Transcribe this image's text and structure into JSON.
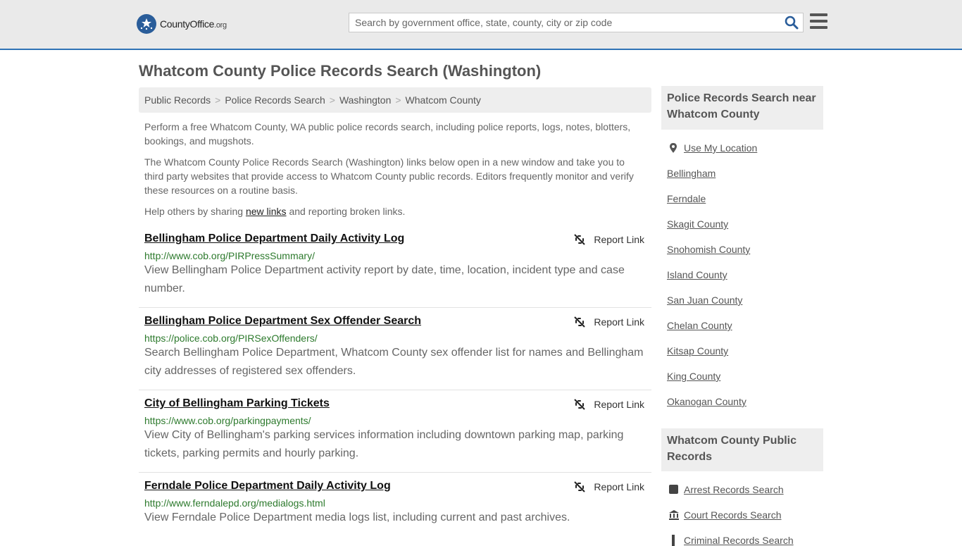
{
  "header": {
    "logo_text": "CountyOffice",
    "logo_suffix": ".org",
    "search_placeholder": "Search by government office, state, county, city or zip code"
  },
  "page": {
    "title": "Whatcom County Police Records Search (Washington)"
  },
  "breadcrumb": [
    "Public Records",
    "Police Records Search",
    "Washington",
    "Whatcom County"
  ],
  "intro": {
    "p1": "Perform a free Whatcom County, WA public police records search, including police reports, logs, notes, blotters, bookings, and mugshots.",
    "p2": "The Whatcom County Police Records Search (Washington) links below open in a new window and take you to third party websites that provide access to Whatcom County public records. Editors frequently monitor and verify these resources on a routine basis.",
    "p3_before": "Help others by sharing ",
    "p3_link": "new links",
    "p3_after": " and reporting broken links."
  },
  "report_label": "Report Link",
  "results": [
    {
      "title": "Bellingham Police Department Daily Activity Log",
      "url": "http://www.cob.org/PIRPressSummary/",
      "desc": "View Bellingham Police Department activity report by date, time, location, incident type and case number."
    },
    {
      "title": "Bellingham Police Department Sex Offender Search",
      "url": "https://police.cob.org/PIRSexOffenders/",
      "desc": "Search Bellingham Police Department, Whatcom County sex offender list for names and Bellingham city addresses of registered sex offenders."
    },
    {
      "title": "City of Bellingham Parking Tickets",
      "url": "https://www.cob.org/parkingpayments/",
      "desc": "View City of Bellingham's parking services information including downtown parking map, parking tickets, parking permits and hourly parking."
    },
    {
      "title": "Ferndale Police Department Daily Activity Log",
      "url": "http://www.ferndalepd.org/medialogs.html",
      "desc": "View Ferndale Police Department media logs list, including current and past archives."
    }
  ],
  "sidebar": {
    "nearby_heading": "Police Records Search near Whatcom County",
    "use_location": "Use My Location",
    "nearby": [
      "Bellingham",
      "Ferndale",
      "Skagit County",
      "Snohomish County",
      "Island County",
      "San Juan County",
      "Chelan County",
      "Kitsap County",
      "King County",
      "Okanogan County"
    ],
    "public_heading": "Whatcom County Public Records",
    "public_links": [
      {
        "label": "Arrest Records Search",
        "icon": "square-icon"
      },
      {
        "label": "Court Records Search",
        "icon": "courthouse-icon"
      },
      {
        "label": "Criminal Records Search",
        "icon": "handcuff-icon"
      }
    ]
  },
  "colors": {
    "accent": "#2f73b5",
    "url_green": "#2d7a2d",
    "header_bg": "#eaeaea",
    "panel_bg": "#eeeeee"
  }
}
